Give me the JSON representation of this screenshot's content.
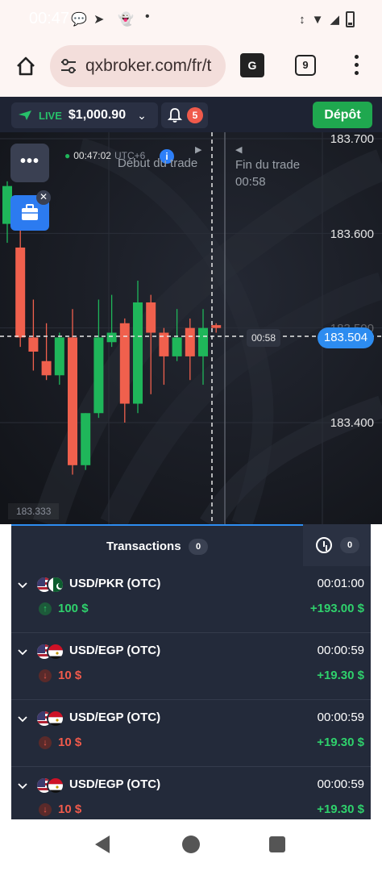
{
  "status_bar": {
    "time": "00:47",
    "icons": [
      "chat-icon",
      "telegram-icon",
      "snapchat-icon",
      "dot-icon"
    ],
    "right_icons": [
      "vibrate-icon",
      "wifi-icon",
      "signal-icon",
      "battery-icon"
    ]
  },
  "browser": {
    "url": "qxbroker.com/fr/t",
    "tab_count": "9",
    "translate_label": "G"
  },
  "account": {
    "mode": "LIVE",
    "balance": "$1,000.90",
    "notifications": "5",
    "deposit_label": "Dépôt"
  },
  "chart": {
    "time": "00:47:02",
    "timezone": "UTC+6",
    "start_label": "Début du trade",
    "end_label": "Fin du trade",
    "end_time": "00:58",
    "countdown": "00:58",
    "current_price": "183.504",
    "price_ticks": [
      "183.700",
      "183.600",
      "183.500",
      "183.400"
    ],
    "low_price": "183.333",
    "edge_text": "00",
    "colors": {
      "up": "#1fb65a",
      "down": "#f0604d",
      "accent": "#2d8cf0"
    },
    "candles": [
      {
        "o": 183.61,
        "c": 183.65,
        "h": 183.655,
        "l": 183.59,
        "up": true
      },
      {
        "o": 183.585,
        "c": 183.49,
        "h": 183.61,
        "l": 183.48,
        "up": false
      },
      {
        "o": 183.49,
        "c": 183.475,
        "h": 183.53,
        "l": 183.455,
        "up": false
      },
      {
        "o": 183.465,
        "c": 183.45,
        "h": 183.505,
        "l": 183.445,
        "up": false
      },
      {
        "o": 183.45,
        "c": 183.49,
        "h": 183.495,
        "l": 183.44,
        "up": true
      },
      {
        "o": 183.49,
        "c": 183.355,
        "h": 183.52,
        "l": 183.345,
        "up": false
      },
      {
        "o": 183.355,
        "c": 183.41,
        "h": 183.41,
        "l": 183.35,
        "up": true
      },
      {
        "o": 183.41,
        "c": 183.49,
        "h": 183.53,
        "l": 183.405,
        "up": true
      },
      {
        "o": 183.485,
        "c": 183.495,
        "h": 183.535,
        "l": 183.48,
        "up": true
      },
      {
        "o": 183.505,
        "c": 183.42,
        "h": 183.51,
        "l": 183.4,
        "up": false
      },
      {
        "o": 183.42,
        "c": 183.527,
        "h": 183.55,
        "l": 183.41,
        "up": true
      },
      {
        "o": 183.527,
        "c": 183.495,
        "h": 183.535,
        "l": 183.43,
        "up": false
      },
      {
        "o": 183.495,
        "c": 183.47,
        "h": 183.5,
        "l": 183.44,
        "up": false
      },
      {
        "o": 183.47,
        "c": 183.49,
        "h": 183.52,
        "l": 183.465,
        "up": true
      },
      {
        "o": 183.5,
        "c": 183.47,
        "h": 183.51,
        "l": 183.445,
        "up": false
      },
      {
        "o": 183.47,
        "c": 183.5,
        "h": 183.52,
        "l": 183.44,
        "up": true
      },
      {
        "o": 183.503,
        "c": 183.5,
        "h": 183.505,
        "l": 183.495,
        "up": false
      }
    ]
  },
  "transactions": {
    "tab_label": "Transactions",
    "tab_count": "0",
    "history_count": "0",
    "items": [
      {
        "pair": "USD/PKR (OTC)",
        "time": "00:01:00",
        "amount": "100 $",
        "direction": "up",
        "payout": "+193.00 $",
        "flag2": "pk"
      },
      {
        "pair": "USD/EGP (OTC)",
        "time": "00:00:59",
        "amount": "10 $",
        "direction": "down",
        "payout": "+19.30 $",
        "flag2": "eg"
      },
      {
        "pair": "USD/EGP (OTC)",
        "time": "00:00:59",
        "amount": "10 $",
        "direction": "down",
        "payout": "+19.30 $",
        "flag2": "eg"
      },
      {
        "pair": "USD/EGP (OTC)",
        "time": "00:00:59",
        "amount": "10 $",
        "direction": "down",
        "payout": "+19.30 $",
        "flag2": "eg"
      }
    ]
  }
}
